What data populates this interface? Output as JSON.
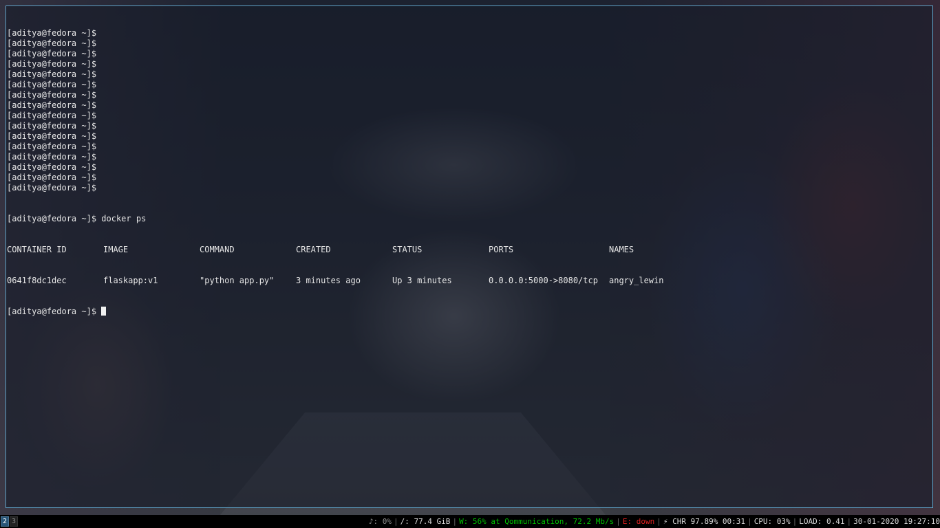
{
  "terminal": {
    "prompt": "[aditya@fedora ~]$",
    "empty_prompt_count": 16,
    "command": "docker ps",
    "table": {
      "headers": [
        "CONTAINER ID",
        "IMAGE",
        "COMMAND",
        "CREATED",
        "STATUS",
        "PORTS",
        "NAMES"
      ],
      "rows": [
        [
          "0641f8dc1dec",
          "flaskapp:v1",
          "\"python app.py\"",
          "3 minutes ago",
          "Up 3 minutes",
          "0.0.0.0:5000->8080/tcp",
          "angry_lewin"
        ]
      ]
    },
    "final_prompt": "[aditya@fedora ~]$"
  },
  "bar": {
    "workspaces": [
      {
        "label": "2",
        "focused": true
      },
      {
        "label": "3",
        "focused": false
      }
    ],
    "volume": "♪: 0%",
    "disk": "/: 77.4 GiB",
    "wireless": "W: 56% at Qommunication, 72.2 Mb/s",
    "ethernet": "E: down",
    "battery": "⚡ CHR 97.89% 00:31",
    "cpu": "CPU: 03%",
    "load": "LOAD: 0.41",
    "datetime": "30-01-2020 19:27:10"
  },
  "colors": {
    "terminal_border": "#5fa3c9",
    "status_good": "#00c000",
    "status_bad": "#e02020",
    "workspace_focused": "#285577"
  }
}
